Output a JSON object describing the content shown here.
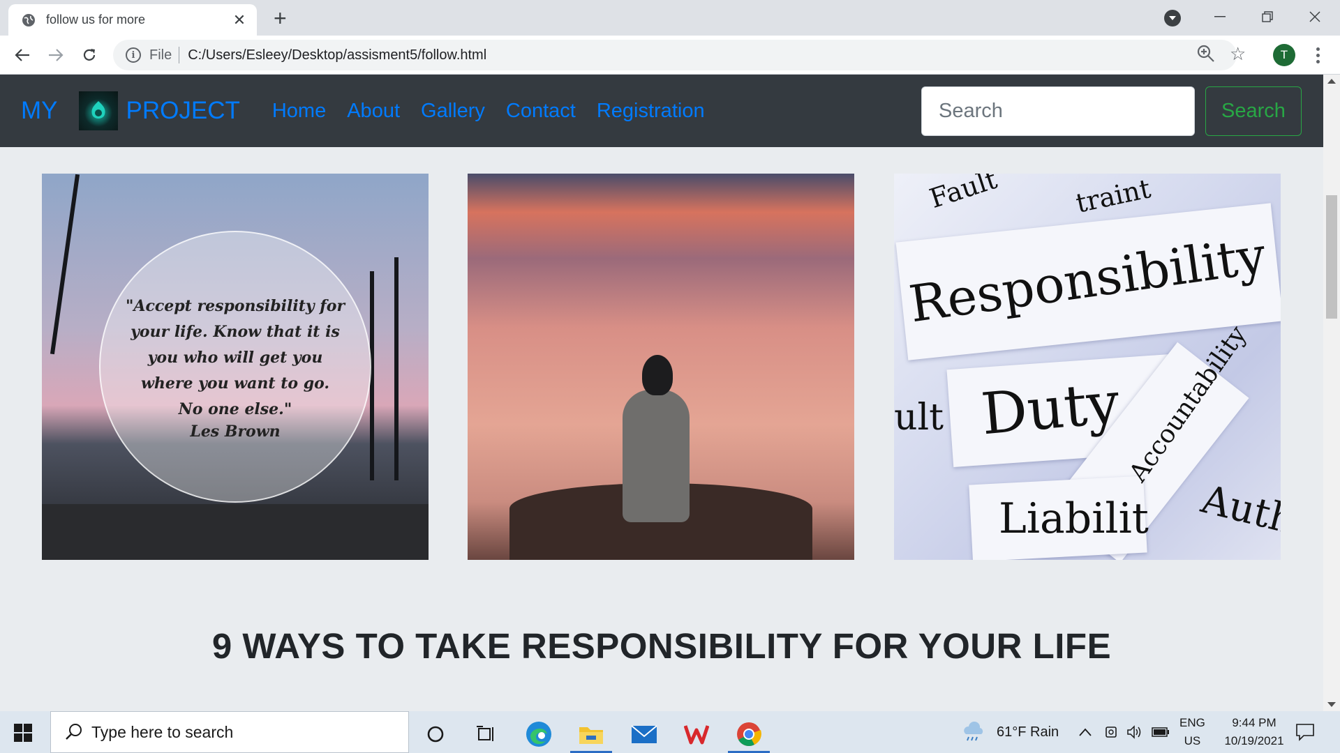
{
  "browser": {
    "tab_title": "follow us for more",
    "scheme_label": "File",
    "url": "C:/Users/Esleey/Desktop/assisment5/follow.html",
    "profile_initial": "T"
  },
  "site": {
    "brand_left": "MY",
    "brand_right": "PROJECT",
    "nav": [
      "Home",
      "About",
      "Gallery",
      "Contact",
      "Registration"
    ],
    "search_placeholder": "Search",
    "search_button": "Search"
  },
  "gallery": {
    "quote_lines": [
      "\"Accept responsibility for",
      "your life. Know that it is",
      "you who will get you",
      "where you want to go.",
      "No one else.\""
    ],
    "quote_author": "Les Brown",
    "words": {
      "fault_top": "Fault",
      "traint": "traint",
      "responsibility": "Responsibility",
      "duty": "Duty",
      "ult": "ult",
      "accountability": "Accountability",
      "liability": "Liabilit",
      "auth": "Auth"
    }
  },
  "main": {
    "heading": "9 WAYS TO TAKE RESPONSIBILITY FOR YOUR LIFE"
  },
  "taskbar": {
    "search_placeholder": "Type here to search",
    "weather": "61°F  Rain",
    "lang_top": "ENG",
    "lang_bottom": "US",
    "time": "9:44 PM",
    "date": "10/19/2021"
  }
}
